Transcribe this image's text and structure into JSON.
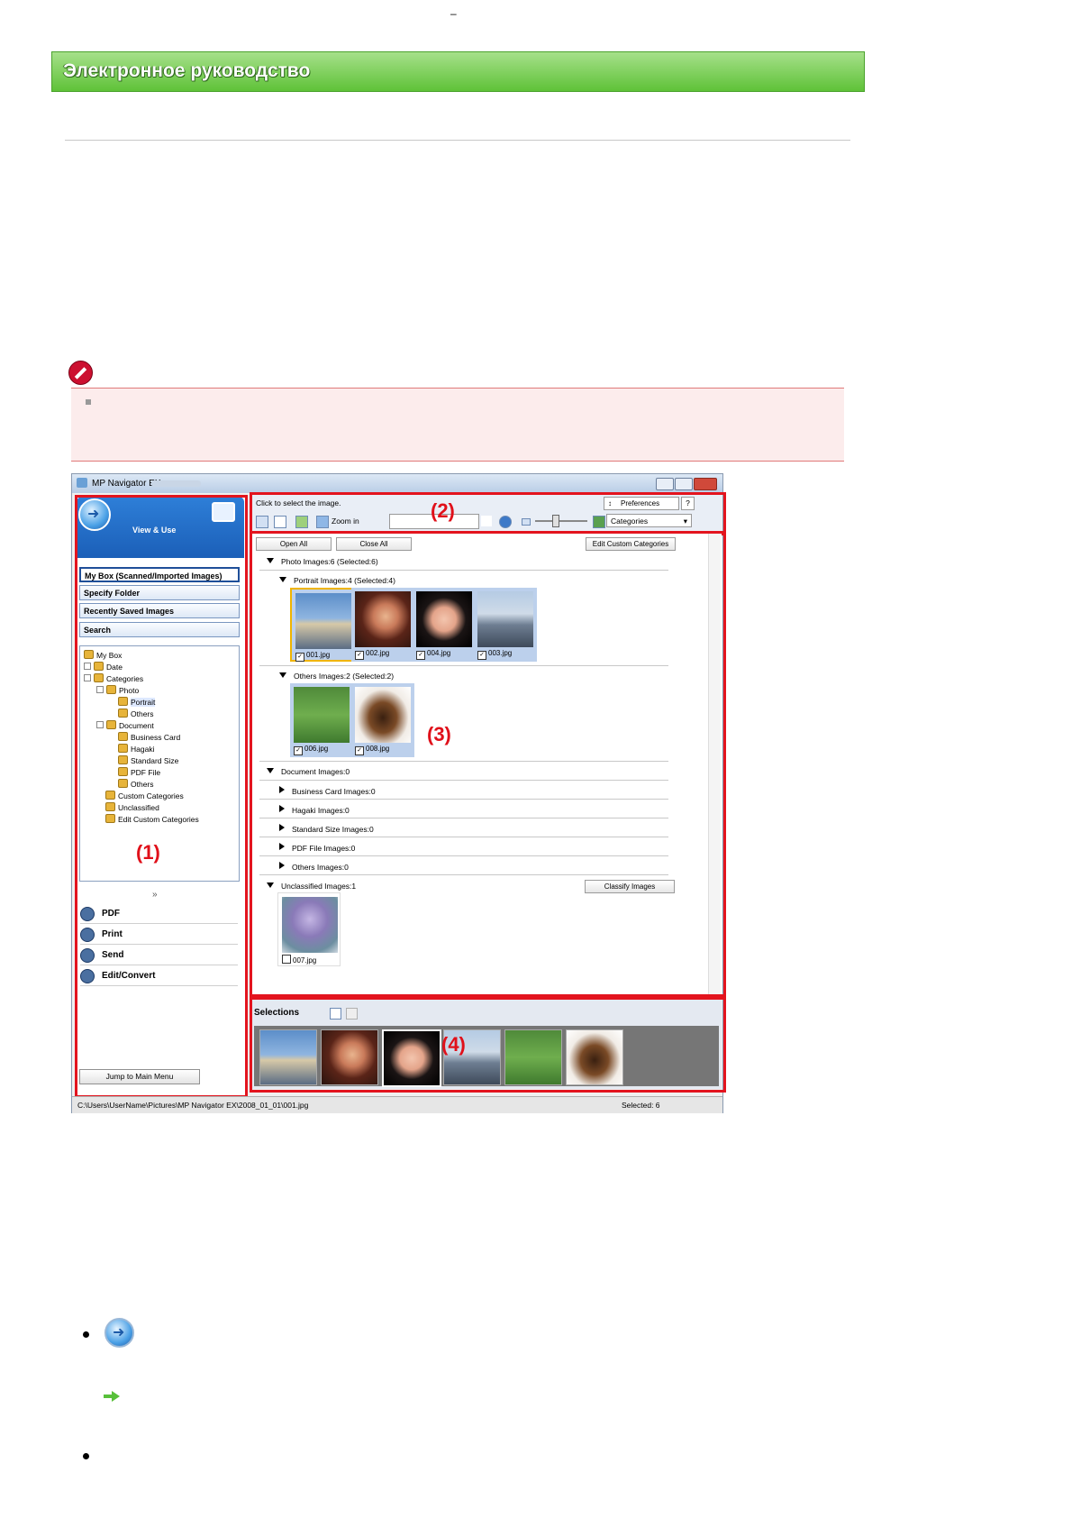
{
  "page": {
    "dash": "–",
    "banner_title": "Электронное руководство"
  },
  "window": {
    "title": "MP Navigator EX"
  },
  "left_pane": {
    "mode_label": "View & Use",
    "nav_buttons": [
      "My Box (Scanned/Imported Images)",
      "Specify Folder",
      "Recently Saved Images",
      "Search"
    ],
    "tree": [
      "My Box",
      "Date",
      "Categories",
      "Photo",
      "Portrait",
      "Others",
      "Document",
      "Business Card",
      "Hagaki",
      "Standard Size",
      "PDF File",
      "Others",
      "Custom Categories",
      "Unclassified",
      "Edit Custom Categories"
    ],
    "actions": [
      "PDF",
      "Print",
      "Send",
      "Edit/Convert"
    ],
    "jump_button": "Jump to Main Menu",
    "chevron": "»"
  },
  "toolbar": {
    "hint": "Click to select the image.",
    "preferences": "Preferences",
    "help": "?",
    "zoom_label": "Zoom in",
    "category_select": "Categories"
  },
  "content": {
    "open_all": "Open All",
    "close_all": "Close All",
    "edit_custom": "Edit Custom Categories",
    "classify": "Classify Images",
    "groups": {
      "photo": "Photo    Images:6    (Selected:6)",
      "portrait": "Portrait    Images:4    (Selected:4)",
      "others": "Others    Images:2    (Selected:2)",
      "document": "Document    Images:0",
      "business": "Business Card    Images:0",
      "hagaki": "Hagaki    Images:0",
      "standard": "Standard Size    Images:0",
      "pdf": "PDF File    Images:0",
      "doc_others": "Others    Images:0",
      "unclassified": "Unclassified    Images:1"
    },
    "thumbs": [
      "001.jpg",
      "002.jpg",
      "004.jpg",
      "003.jpg",
      "006.jpg",
      "008.jpg",
      "007.jpg"
    ]
  },
  "selections": {
    "label": "Selections"
  },
  "status": {
    "path": "C:\\Users\\UserName\\Pictures\\MP Navigator EX\\2008_01_01\\001.jpg",
    "selected": "Selected: 6"
  },
  "labels": [
    "(1)",
    "(2)",
    "(3)",
    "(4)"
  ],
  "colors": {
    "highlight_red": "#e3141e",
    "banner_green": "#5fc238"
  }
}
